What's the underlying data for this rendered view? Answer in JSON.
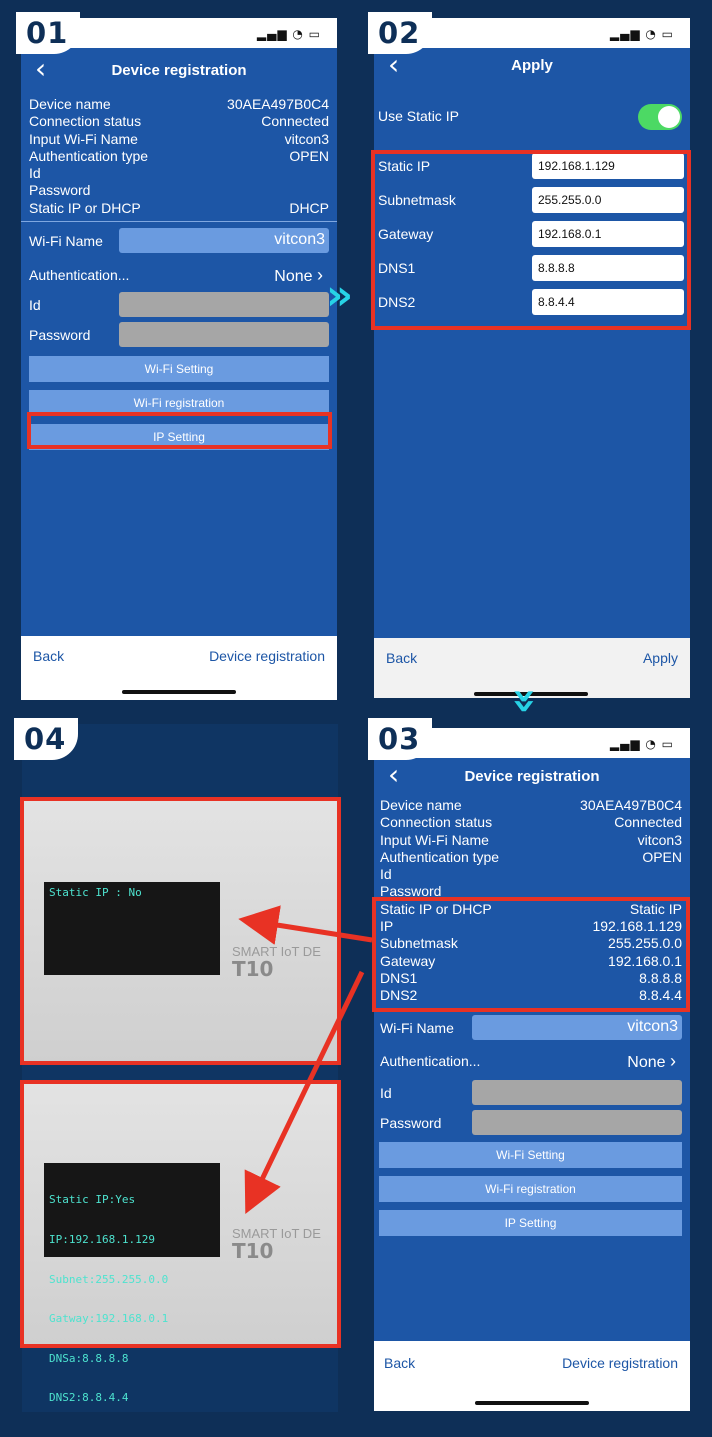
{
  "steps": [
    "01",
    "02",
    "03",
    "04"
  ],
  "status_bar": {
    "signal_icons": "▂▄▆ ◔ ▭"
  },
  "screen1": {
    "title": "Device registration",
    "info": [
      {
        "label": "Device name",
        "value": "30AEA497B0C4"
      },
      {
        "label": "Connection status",
        "value": "Connected"
      },
      {
        "label": "Input Wi-Fi Name",
        "value": "vitcon3"
      },
      {
        "label": "Authentication type",
        "value": "OPEN"
      },
      {
        "label": "Id",
        "value": ""
      },
      {
        "label": "Password",
        "value": ""
      },
      {
        "label": "Static IP or DHCP",
        "value": "DHCP"
      }
    ],
    "wifi_name_label": "Wi-Fi Name",
    "wifi_name_value": "vitcon3",
    "auth_label": "Authentication...",
    "auth_value": "None",
    "id_label": "Id",
    "password_label": "Password",
    "btn_wifi_setting": "Wi-Fi Setting",
    "btn_wifi_registration": "Wi-Fi registration",
    "btn_ip_setting": "IP Setting",
    "back": "Back",
    "bottom_right": "Device registration"
  },
  "screen2": {
    "title": "Apply",
    "use_static_ip_label": "Use Static IP",
    "use_static_ip": true,
    "fields": [
      {
        "label": "Static IP",
        "value": "192.168.1.129"
      },
      {
        "label": "Subnetmask",
        "value": "255.255.0.0"
      },
      {
        "label": "Gateway",
        "value": "192.168.0.1"
      },
      {
        "label": "DNS1",
        "value": "8.8.8.8"
      },
      {
        "label": "DNS2",
        "value": "8.8.4.4"
      }
    ],
    "back": "Back",
    "apply": "Apply"
  },
  "screen3": {
    "title": "Device registration",
    "info": [
      {
        "label": "Device name",
        "value": "30AEA497B0C4"
      },
      {
        "label": "Connection status",
        "value": "Connected"
      },
      {
        "label": "Input Wi-Fi Name",
        "value": "vitcon3"
      },
      {
        "label": "Authentication type",
        "value": "OPEN"
      },
      {
        "label": "Id",
        "value": ""
      },
      {
        "label": "Password",
        "value": ""
      }
    ],
    "ip_info": [
      {
        "label": "Static IP or DHCP",
        "value": "Static IP"
      },
      {
        "label": "IP",
        "value": "192.168.1.129"
      },
      {
        "label": "Subnetmask",
        "value": "255.255.0.0"
      },
      {
        "label": "Gateway",
        "value": "192.168.0.1"
      },
      {
        "label": "DNS1",
        "value": "8.8.8.8"
      },
      {
        "label": "DNS2",
        "value": "8.8.4.4"
      }
    ],
    "wifi_name_label": "Wi-Fi Name",
    "wifi_name_value": "vitcon3",
    "auth_label": "Authentication...",
    "auth_value": "None",
    "id_label": "Id",
    "password_label": "Password",
    "btn_wifi_setting": "Wi-Fi Setting",
    "btn_wifi_registration": "Wi-Fi registration",
    "btn_ip_setting": "IP Setting",
    "back": "Back",
    "bottom_right": "Device registration"
  },
  "device_before": {
    "lcd": "Static IP : No",
    "brand": "SMART IoT DE",
    "model": "T10"
  },
  "device_after": {
    "lcd_lines": [
      "Static IP:Yes",
      "IP:192.168.1.129",
      "Subnet:255.255.0.0",
      "Gatway:192.168.0.1",
      "DNSa:8.8.8.8",
      "DNS2:8.8.4.4"
    ],
    "brand": "SMART IoT DE",
    "model": "T10"
  },
  "colors": {
    "screen_blue": "#1d56a6",
    "highlight_red": "#e83224",
    "arrow_cyan": "#27d3e6",
    "toggle_green": "#4cd964"
  }
}
